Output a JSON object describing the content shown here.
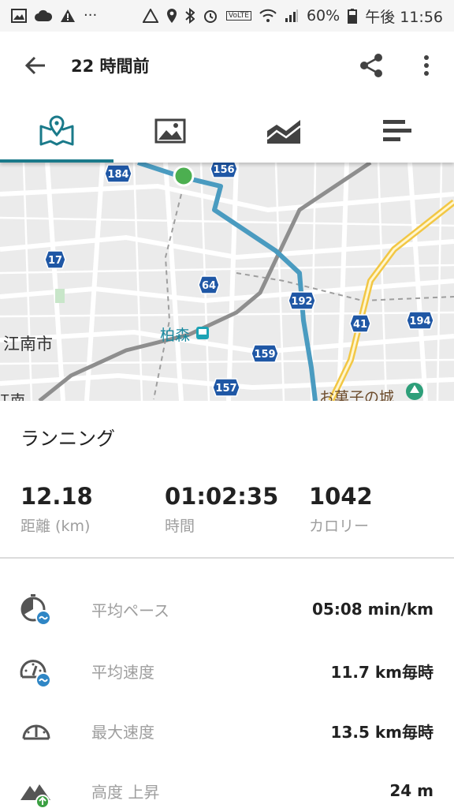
{
  "status_bar": {
    "battery": "60%",
    "time": "午後 11:56",
    "volte": "VoLTE"
  },
  "app_bar": {
    "title": "22 時間前"
  },
  "tabs": [
    {
      "icon": "map-pin-book-icon",
      "active": true
    },
    {
      "icon": "photo-icon",
      "active": false
    },
    {
      "icon": "area-chart-icon",
      "active": false
    },
    {
      "icon": "bar-list-icon",
      "active": false
    }
  ],
  "map": {
    "labels": {
      "city_konan": "江南市",
      "station_kashiwamori": "柏森",
      "poi_okashi": "お菓子の城",
      "partial_label": "江南"
    },
    "road_numbers": [
      "184",
      "156",
      "17",
      "64",
      "192",
      "41",
      "194",
      "159",
      "157"
    ],
    "route_color": "#4a9bc0",
    "start_marker_color": "#4caf50"
  },
  "activity": {
    "type": "ランニング"
  },
  "summary": {
    "distance": {
      "value": "12.18",
      "label": "距離 (km)"
    },
    "duration": {
      "value": "01:02:35",
      "label": "時間"
    },
    "calories": {
      "value": "1042",
      "label": "カロリー"
    }
  },
  "metrics": [
    {
      "icon": "pace-icon",
      "label": "平均ペース",
      "value": "05:08 min/km"
    },
    {
      "icon": "avg-speed-icon",
      "label": "平均速度",
      "value": "11.7 km毎時"
    },
    {
      "icon": "max-speed-icon",
      "label": "最大速度",
      "value": "13.5 km毎時"
    },
    {
      "icon": "elevation-gain-icon",
      "label": "高度 上昇",
      "value": "24 m"
    }
  ],
  "colors": {
    "accent": "#1a7a8a",
    "route": "#4a9bc0",
    "metric_icon_badge": "#2f86c5"
  }
}
